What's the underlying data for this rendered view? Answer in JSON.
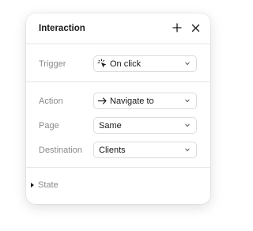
{
  "panel": {
    "title": "Interaction",
    "add_icon": "plus-icon",
    "close_icon": "close-icon"
  },
  "trigger": {
    "label": "Trigger",
    "value": "On click",
    "icon": "click-icon"
  },
  "action": {
    "label": "Action",
    "value": "Navigate to",
    "icon": "arrow-right-icon"
  },
  "page": {
    "label": "Page",
    "value": "Same"
  },
  "destination": {
    "label": "Destination",
    "value": "Clients"
  },
  "state": {
    "label": "State",
    "icon": "chevron-right-icon"
  },
  "colors": {
    "label_text": "#8a8a8a",
    "value_text": "#1a1a1a",
    "border": "#dcdcdc",
    "divider": "#e6e6e6"
  }
}
